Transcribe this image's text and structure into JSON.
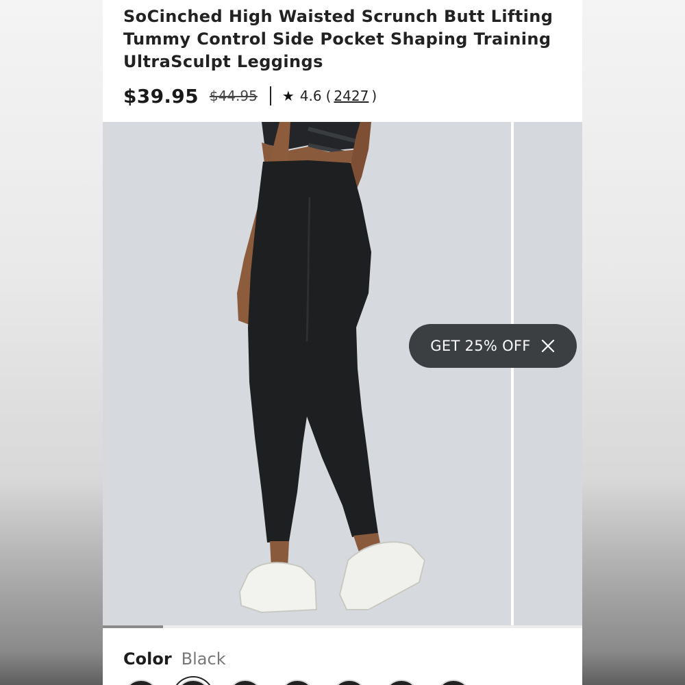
{
  "product": {
    "title": "SoCinched High Waisted Scrunch Butt Lifting Tummy Control Side Pocket Shaping Training UltraSculpt Leggings",
    "price_current": "$39.95",
    "price_original": "$44.95",
    "rating": "4.6",
    "review_count": "2427",
    "paren_open": "(",
    "paren_close": ")"
  },
  "gallery": {
    "main_image_icon": "leggings-product-photo",
    "progress_fraction": 0.125
  },
  "promo": {
    "label": "GET 25% OFF",
    "close_icon": "close-icon"
  },
  "color": {
    "label": "Color",
    "value": "Black"
  },
  "colors": {
    "background": "#ffffff",
    "image_bg": "#d5d9de",
    "promo_bg": "#3c3f42",
    "text": "#222222"
  }
}
